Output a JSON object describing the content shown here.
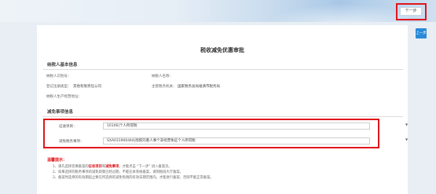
{
  "header": {
    "next_top_label": "下一步",
    "next_side_label": "上一步"
  },
  "page": {
    "title": "税收减免优惠审批"
  },
  "taxpayer": {
    "section_title": "纳税人基本信息",
    "id_label": "纳税人识别号：",
    "name_label": "纳税人名称：",
    "reg_type_label": "登记注册类型：",
    "reg_type_value": "其他有限责任公司",
    "authority_label": "主管税务机关：",
    "authority_value": "国家税务总局福清市税务局",
    "address_label": "纳税人生产经营地址："
  },
  "relief": {
    "section_title": "减免事项信息",
    "tax_label": "征收项目：",
    "tax_value": "10106|个人所得税",
    "item_label": "减免税务事项：",
    "item_value": "SXA031900444|残疾的看人事个非经营免征个人所得税"
  },
  "tips": {
    "title": "温馨提示：",
    "line1_pre": "1、请先选择您要备案的",
    "line1_hl": "征收项目",
    "line1_mid": "和",
    "line1_hl2": "减免事项",
    "line1_post": "，才能点击 “下一步” 进入备案页。",
    "line2": "2、如果选择的税务事项的减免政策已经过期，不能在本系统备案，请到税局大厅备案。",
    "line3": "3、备案时选择的有效期起止要在所选择的减免免税的有效日期范围内，才能进行备案，否则不能正常备案。"
  },
  "colors": {
    "highlight": "#e0161b",
    "accent": "#2b8ad6"
  }
}
